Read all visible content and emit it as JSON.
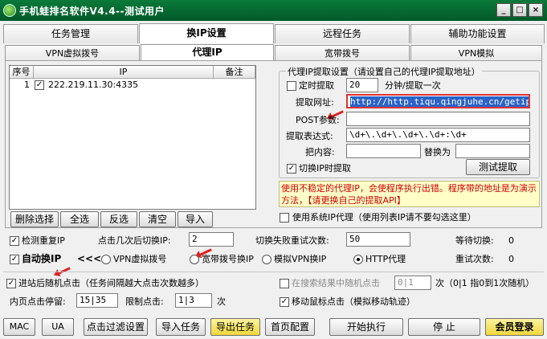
{
  "window": {
    "title": "手机蛙排名软件V4.4--测试用户",
    "min": "_",
    "max": "□",
    "close": "×"
  },
  "tabs": [
    "任务管理",
    "换IP设置",
    "远程任务",
    "辅助功能设置"
  ],
  "subtabs": [
    "VPN虚拟拨号",
    "代理IP",
    "宽带拨号",
    "VPN模拟"
  ],
  "list": {
    "headers": [
      "序号",
      "IP",
      "备注"
    ],
    "rows": [
      {
        "num": "1",
        "ip": "222.219.11.30:4335",
        "note": ""
      }
    ]
  },
  "list_buttons": [
    "删除选择",
    "全选",
    "反选",
    "清空",
    "导入"
  ],
  "proxy_group": {
    "legend": "代理IP提取设置（请设置自己的代理IP提取地址）",
    "timed_label": "定时提取",
    "timed_value": "20",
    "timed_unit": "分钟/提取一次",
    "url_label": "提取网址:",
    "url_value": "http://http.tiqu.qingjuhe.cn/getip?num",
    "post_label": "POST参数:",
    "post_value": "",
    "regex_label": "提取表达式:",
    "regex_value": "\\d+\\.\\d+\\.\\d+\\.\\d+:\\d+",
    "content_label": "把内容:",
    "content_value": "",
    "replace_label": "替换为",
    "replace_value": "",
    "switch_label": "切换IP时提取",
    "test_button": "测试提取"
  },
  "warning": "使用不稳定的代理IP，会使程序执行出错。程序带的地址是为演示方法，【请更换自己的提取API】",
  "system_proxy_label": "使用系统IP代理（使用列表IP请不要勾选这里）",
  "options": {
    "check_dup": "检测重复IP",
    "clicks_label": "点击几次后切换IP:",
    "clicks_value": "2",
    "retry_label": "切换失败重试次数:",
    "retry_value": "50",
    "wait_label": "等待切换:",
    "wait_value": "0",
    "auto_switch": "自动换IP",
    "chevrons": "<<<",
    "radio_vpn": "VPN虚拟拨号",
    "radio_broadband": "宽带拨号换IP",
    "radio_vpn_sim": "模拟VPN换IP",
    "radio_http": "HTTP代理",
    "retries_label": "重试次数:",
    "retries_value": "0"
  },
  "bottom": {
    "random_click_label": "进站后随机点击（任务间隔越大点击次数越多）",
    "search_random_label": "在搜索结果中随机点击",
    "search_random_value": "0|1",
    "search_random_hint": "次（0|1 指0到1次随机）",
    "stay_label": "内页点击停留:",
    "stay_value": "15|35",
    "limit_label": "限制点击:",
    "limit_value": "1|3",
    "limit_unit": "次",
    "mouse_move_label": "移动鼠标点击（模拟移动轨迹）"
  },
  "footer_buttons": [
    "MAC",
    "UA",
    "点击过滤设置",
    "导入任务",
    "导出任务",
    "首页配置",
    "开始执行",
    "停 止",
    "会员登录"
  ],
  "colors": {
    "titlebar": "#03592a",
    "warning_text": "#d00000",
    "warning_bg": "#ffffc8",
    "accent_yellow": "#f5e24a"
  }
}
